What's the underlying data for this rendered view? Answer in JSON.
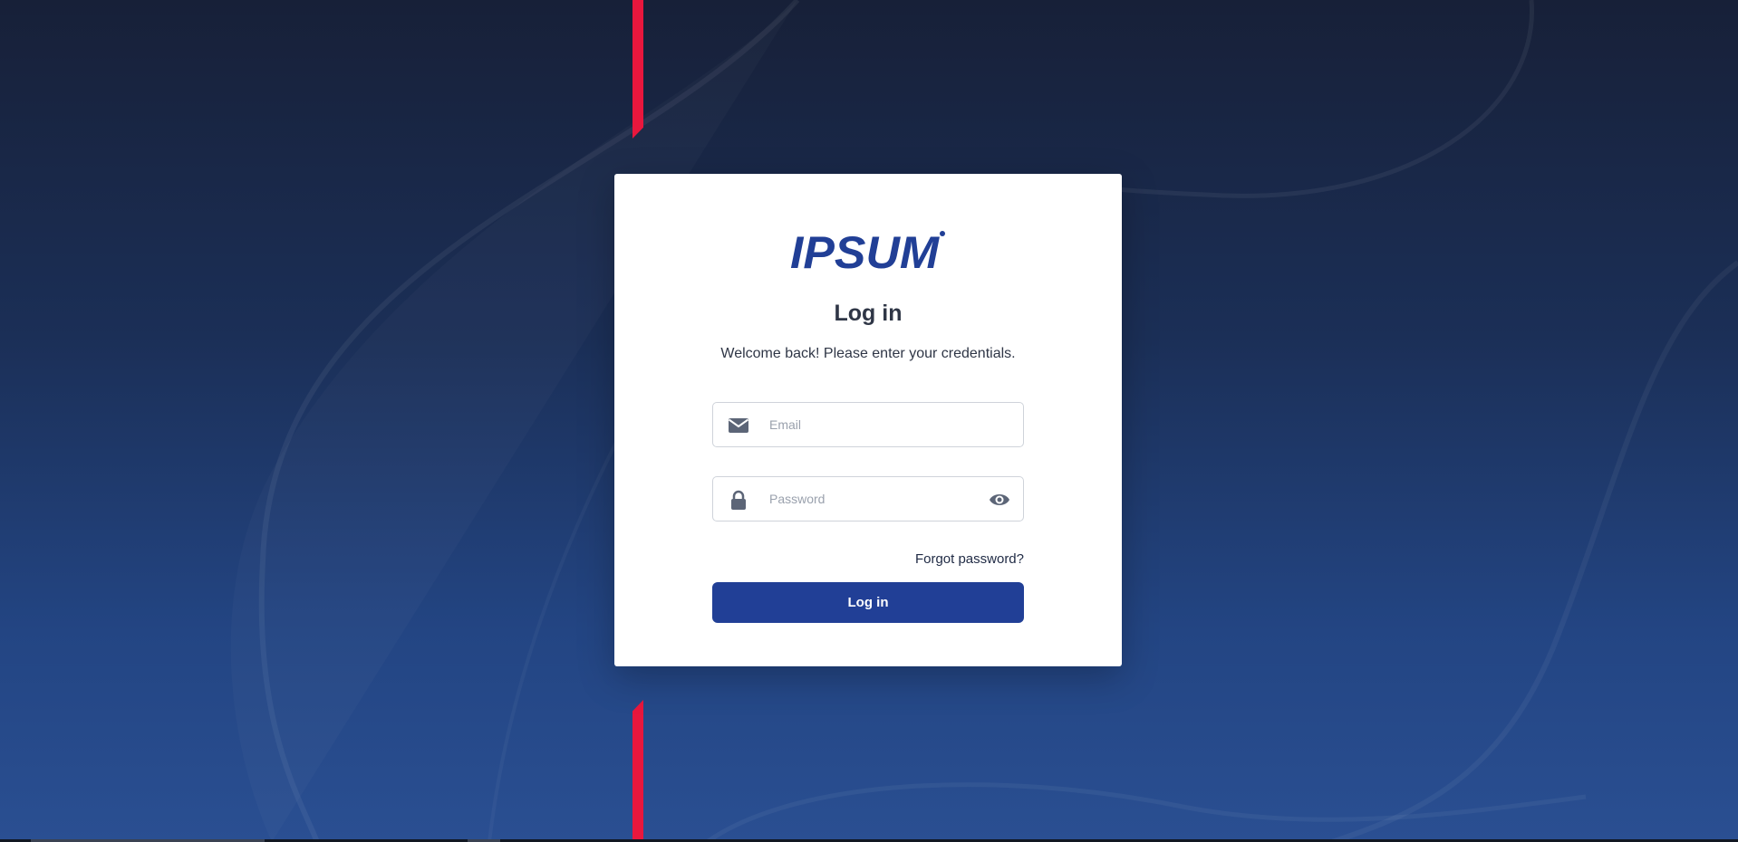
{
  "brand": {
    "logo_text": "IPSUM",
    "logo_color": "#213f96",
    "accent_color": "#e8173d"
  },
  "login": {
    "title": "Log in",
    "subtitle": "Welcome back! Please enter your credentials.",
    "email": {
      "placeholder": "Email",
      "value": "",
      "icon": "envelope-icon"
    },
    "password": {
      "placeholder": "Password",
      "value": "",
      "icon": "lock-icon",
      "toggle_icon": "eye-icon"
    },
    "forgot_password": "Forgot password?",
    "submit_label": "Log in",
    "button_color": "#213f96"
  },
  "theme": {
    "background_top": "#172038",
    "background_bottom": "#2a4f92"
  }
}
